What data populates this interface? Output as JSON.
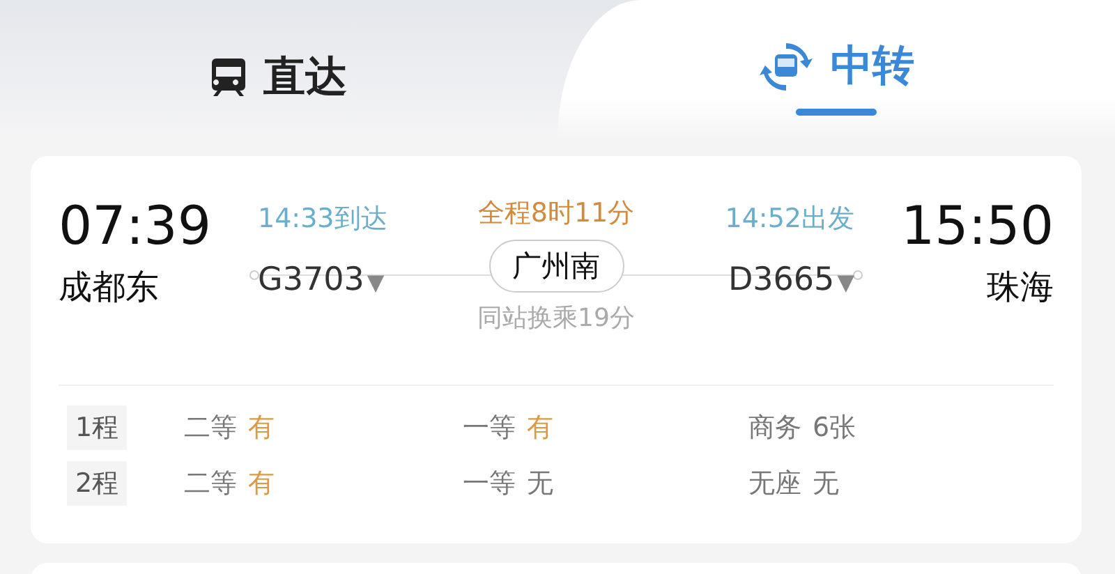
{
  "tabs": [
    {
      "label": "直达",
      "selected": false,
      "kind": "direct"
    },
    {
      "label": "中转",
      "selected": true,
      "kind": "transfer"
    }
  ],
  "trip": {
    "depart_time": "07:39",
    "depart_station": "成都东",
    "arrive_time": "15:50",
    "arrive_station": "珠海",
    "total_duration": "全程8时11分",
    "transfer_station": "广州南",
    "transfer_note": "同站换乘19分",
    "legs": [
      {
        "time": "14:33到达",
        "train": "G3703",
        "caret": "▼"
      },
      {
        "time": "14:52出发",
        "train": "D3665",
        "caret": "▼"
      }
    ]
  },
  "seat_rows": [
    {
      "label": "1程",
      "seats": [
        {
          "class": "二等",
          "status": "有",
          "available": true
        },
        {
          "class": "一等",
          "status": "有",
          "available": true
        },
        {
          "class": "商务",
          "status": "6张",
          "available": false
        }
      ]
    },
    {
      "label": "2程",
      "seats": [
        {
          "class": "二等",
          "status": "有",
          "available": true
        },
        {
          "class": "一等",
          "status": "无",
          "available": false
        },
        {
          "class": "无座",
          "status": "无",
          "available": false
        }
      ]
    }
  ]
}
